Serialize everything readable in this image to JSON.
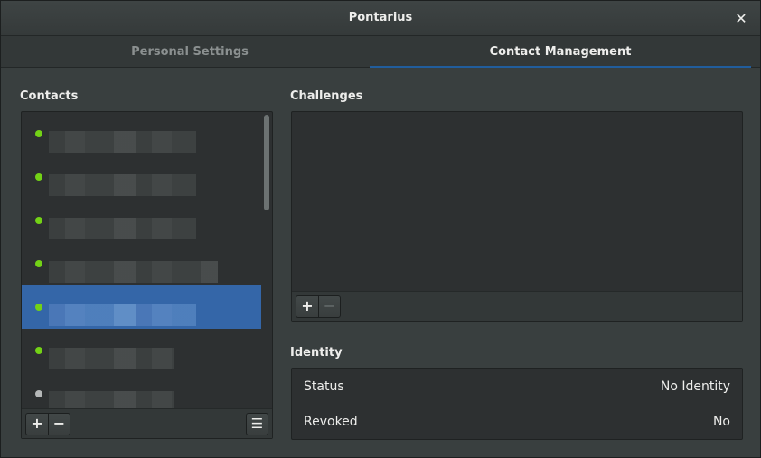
{
  "window": {
    "title": "Pontarius",
    "close_glyph": "✕"
  },
  "tabs": [
    {
      "label": "Personal Settings",
      "active": false
    },
    {
      "label": "Contact Management",
      "active": true
    }
  ],
  "contacts": {
    "heading": "Contacts",
    "items": [
      {
        "status_color": "#73d216",
        "selected": false
      },
      {
        "status_color": "#73d216",
        "selected": false
      },
      {
        "status_color": "#73d216",
        "selected": false
      },
      {
        "status_color": "#73d216",
        "selected": false
      },
      {
        "status_color": "#73d216",
        "selected": true
      },
      {
        "status_color": "#73d216",
        "selected": false
      },
      {
        "status_color": "#b5b8b8",
        "selected": false
      }
    ],
    "add_glyph": "+",
    "remove_glyph": "−",
    "menu_glyph": "☰"
  },
  "challenges": {
    "heading": "Challenges",
    "add_glyph": "+",
    "remove_glyph": "−"
  },
  "identity": {
    "heading": "Identity",
    "rows": [
      {
        "key": "Status",
        "value": "No Identity"
      },
      {
        "key": "Revoked",
        "value": "No"
      }
    ]
  },
  "colors": {
    "accent": "#215d9c",
    "selection": "#3466a8",
    "online": "#73d216",
    "offline": "#b5b8b8"
  }
}
